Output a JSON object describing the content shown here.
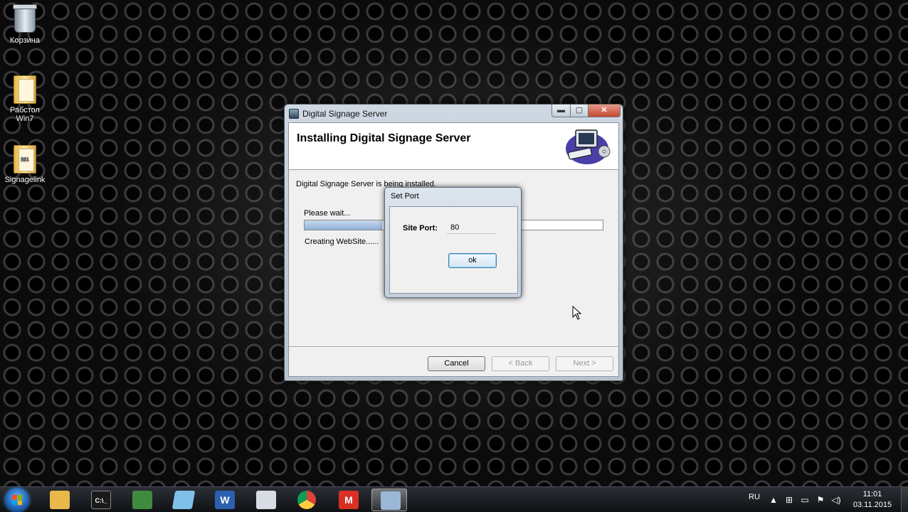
{
  "desktop": {
    "icons": [
      {
        "label": "Корзина",
        "icon": "recycle-bin-icon"
      },
      {
        "label": "Рабстол Win7",
        "icon": "folder-icon"
      },
      {
        "label": "Signagelink",
        "icon": "folder-shortcut-icon"
      }
    ]
  },
  "installer": {
    "title": "Digital Signage Server",
    "controls": {
      "minimize": "▬",
      "maximize": "▢",
      "close": "✕"
    },
    "banner_title": "Installing Digital Signage Server",
    "status_text": "Digital Signage Server is being installed.",
    "wait_text": "Please wait...",
    "progress": 0.26,
    "creating_text": "Creating WebSite......",
    "buttons": {
      "cancel": "Cancel",
      "back": "< Back",
      "next": "Next >"
    }
  },
  "set_port_dialog": {
    "title": "Set Port",
    "label": "Site Port:",
    "value": "80",
    "ok": "ok"
  },
  "taskbar": {
    "apps": [
      {
        "name": "explorer",
        "icon": "folder-icon",
        "color": "#e8b84a",
        "glyph": ""
      },
      {
        "name": "cmd",
        "icon": "terminal-icon",
        "color": "#1a1a1a",
        "glyph": "C:\\_"
      },
      {
        "name": "task-manager",
        "icon": "monitor-icon",
        "color": "#3f8a3f",
        "glyph": ""
      },
      {
        "name": "notepad",
        "icon": "notepad-icon",
        "color": "#7fc0e8",
        "glyph": ""
      },
      {
        "name": "word",
        "icon": "word-icon",
        "color": "#2b5fb0",
        "glyph": "W"
      },
      {
        "name": "calendar",
        "icon": "calendar-icon",
        "color": "#d8dde5",
        "glyph": ""
      },
      {
        "name": "chrome",
        "icon": "chrome-icon",
        "color": "#db4437",
        "glyph": ""
      },
      {
        "name": "gmail",
        "icon": "gmail-icon",
        "color": "#d93025",
        "glyph": "M"
      },
      {
        "name": "installer",
        "icon": "installer-icon",
        "color": "#9ab7d6",
        "glyph": ""
      }
    ],
    "language": "RU",
    "time": "11:01",
    "date": "03.11.2015"
  },
  "colors": {
    "accent": "#3c7fb1",
    "progress": "#8fb0d6"
  }
}
